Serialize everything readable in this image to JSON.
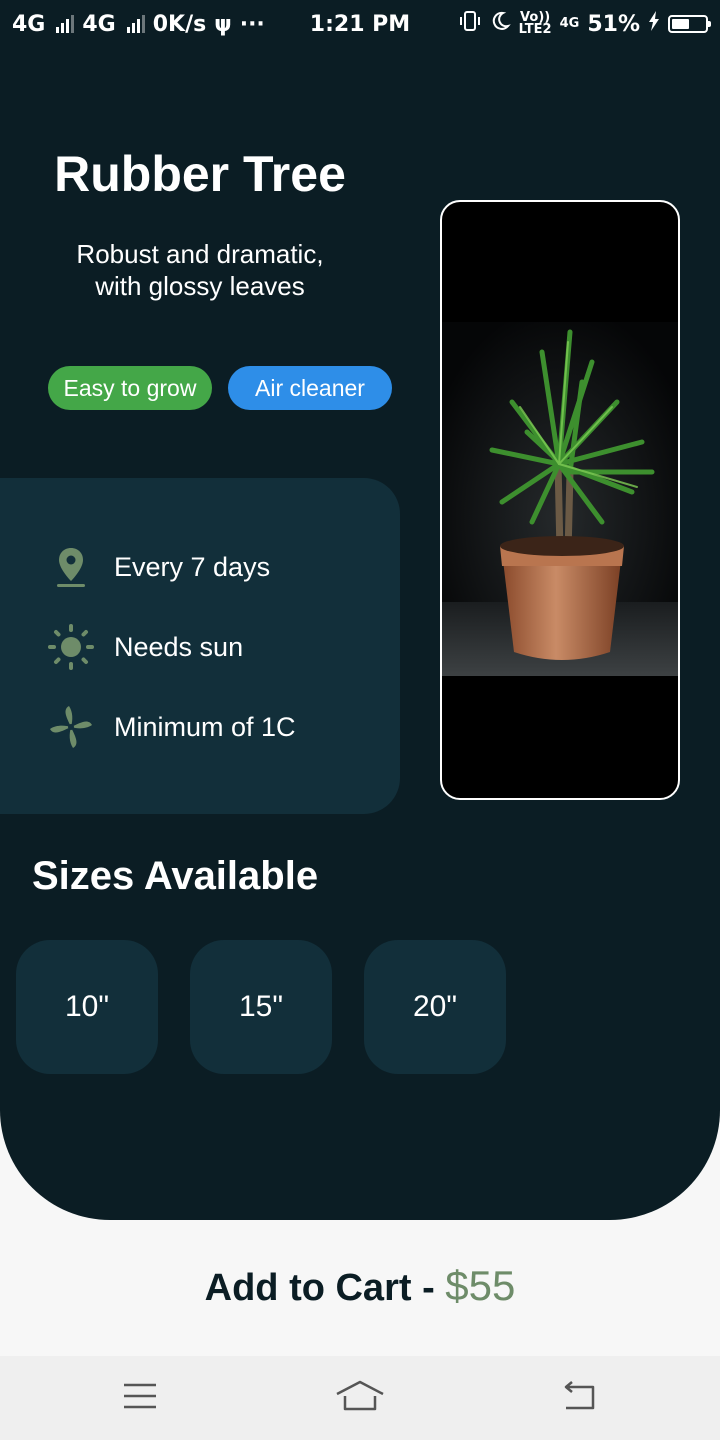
{
  "status_bar": {
    "network_1": "4G",
    "network_2": "4G",
    "speed": "0K/s",
    "more": "···",
    "time": "1:21 PM",
    "volte": "Vo))",
    "lte": "LTE2",
    "net_4g": "4G",
    "battery": "51%"
  },
  "plant": {
    "name": "Rubber Tree",
    "description_line1": "Robust and dramatic,",
    "description_line2": "with glossy leaves",
    "tags": [
      "Easy to grow",
      "Air cleaner"
    ]
  },
  "care": {
    "water": "Every 7 days",
    "light": "Needs sun",
    "temperature": "Minimum of 1C"
  },
  "sizes": {
    "title": "Sizes Available",
    "options": [
      "10\"",
      "15\"",
      "20\""
    ]
  },
  "cart": {
    "label": "Add to Cart - ",
    "price": "$55"
  },
  "colors": {
    "background_dark": "#0b1d24",
    "card": "#122f3a",
    "tag_green": "#44a748",
    "tag_blue": "#2e8ee8",
    "accent": "#6e8c69"
  },
  "icons": [
    "location-pin-icon",
    "sun-icon",
    "fan-icon",
    "menu-icon",
    "home-icon",
    "back-icon"
  ]
}
